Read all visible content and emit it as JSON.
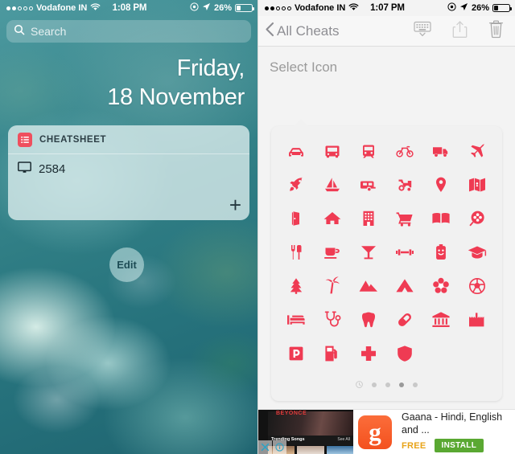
{
  "left": {
    "status": {
      "carrier": "Vodafone IN",
      "time": "1:08 PM",
      "battery": "26%",
      "signal_dots": 2
    },
    "search": {
      "placeholder": "Search",
      "icon": "search-icon"
    },
    "date": {
      "weekday": "Friday,",
      "day_month": "18 November"
    },
    "widget": {
      "app_icon": "cheatsheet-app-icon",
      "title": "CHEATSHEET",
      "rows": [
        {
          "icon": "monitor-icon",
          "label": "2584"
        }
      ],
      "add_label": "+"
    },
    "edit_button": "Edit"
  },
  "right": {
    "status": {
      "carrier": "Vodafone IN",
      "time": "1:07 PM",
      "battery": "26%",
      "signal_dots": 2
    },
    "nav": {
      "back_label": "All Cheats",
      "back_icon": "chevron-left-icon",
      "actions": [
        {
          "name": "keyboard-dismiss-icon"
        },
        {
          "name": "share-icon"
        },
        {
          "name": "trash-icon"
        }
      ]
    },
    "section_label": "Select Icon",
    "icon_grid": [
      "car-icon",
      "bus-icon",
      "train-icon",
      "bicycle-icon",
      "truck-icon",
      "airplane-icon",
      "rocket-icon",
      "sailboat-icon",
      "caravan-icon",
      "tractor-icon",
      "map-pin-icon",
      "map-icon",
      "door-icon",
      "home-icon",
      "building-icon",
      "shopping-cart-icon",
      "book-icon",
      "film-reel-icon",
      "cutlery-icon",
      "coffee-cup-icon",
      "cocktail-icon",
      "dumbbell-icon",
      "toy-face-icon",
      "graduation-cap-icon",
      "pine-tree-icon",
      "palm-tree-icon",
      "mountains-icon",
      "tent-icon",
      "flower-icon",
      "soccer-ball-icon",
      "bed-icon",
      "stethoscope-icon",
      "tooth-icon",
      "pill-icon",
      "bank-icon",
      "factory-icon",
      "parking-icon",
      "fuel-pump-icon",
      "medical-cross-icon",
      "shield-icon"
    ],
    "icon_color": "#ef3b53",
    "pager": {
      "recents_icon": "clock-icon",
      "pages": 4,
      "active_page": 3
    },
    "ad": {
      "thumb_hero_text": "BEYONCE",
      "thumb_row_label": "Trending Songs",
      "thumb_row_action": "See All",
      "logo_letter": "g",
      "title": "Gaana - Hindi, English and ...",
      "price_label": "FREE",
      "install_label": "INSTALL",
      "close_icon": "close-icon",
      "info_icon": "info-icon"
    }
  }
}
